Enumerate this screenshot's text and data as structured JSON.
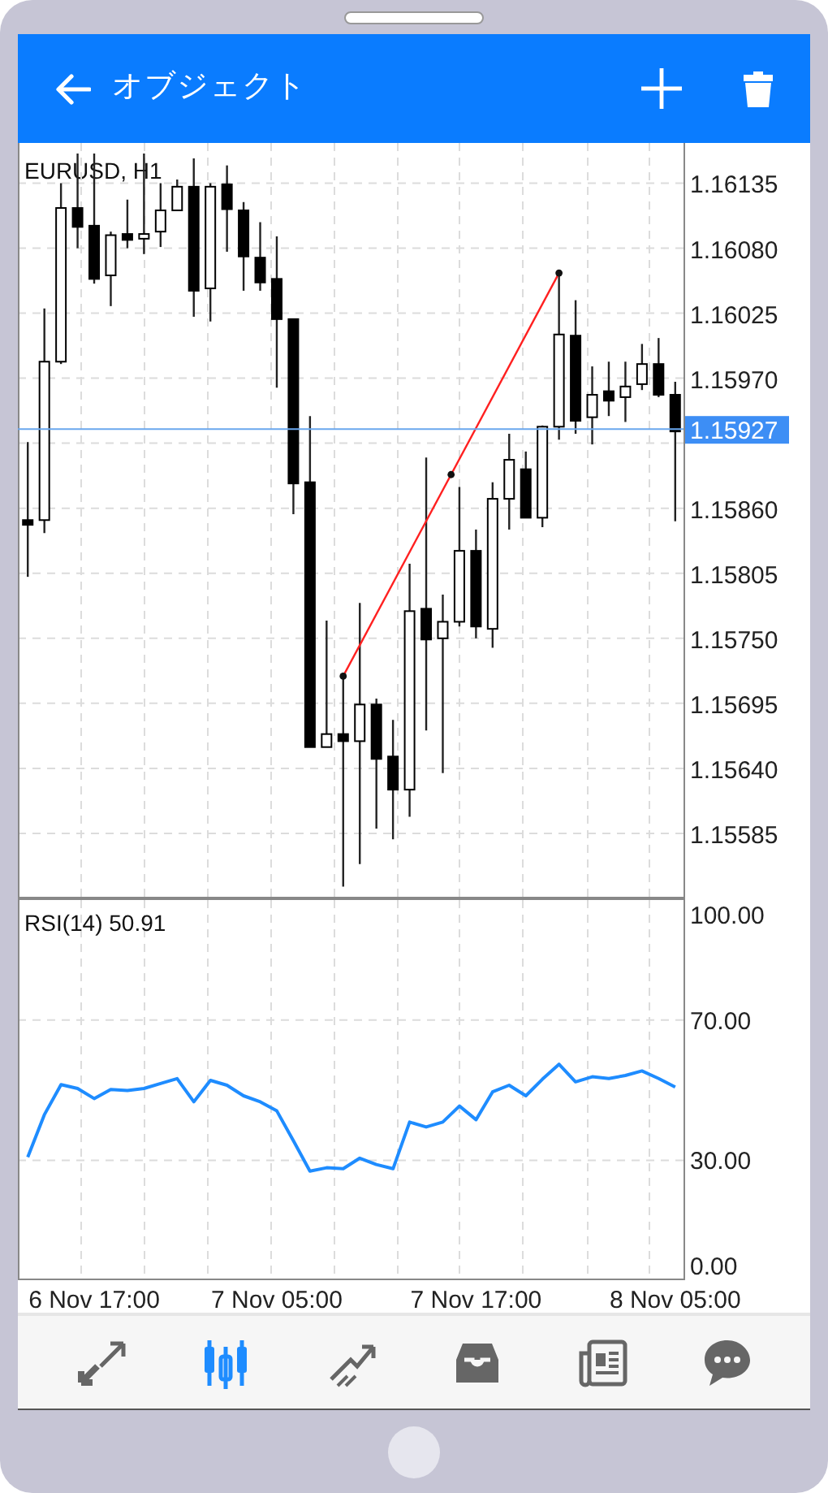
{
  "header": {
    "title": "オブジェクト"
  },
  "price_chart": {
    "current_price": "1.15927",
    "chart_data": {
      "type": "candlestick",
      "title": "EURUSD, H1",
      "grid": true,
      "categories": [
        null,
        null,
        null,
        null,
        null,
        null,
        null,
        null,
        null,
        null,
        null,
        null,
        null,
        null,
        null,
        null,
        null,
        null,
        null,
        null,
        null,
        null,
        null,
        null,
        null,
        null,
        null,
        null,
        null,
        null,
        null,
        null,
        null,
        null,
        null,
        null,
        null,
        null,
        null,
        null
      ],
      "ylim": [
        1.1553,
        1.16169
      ],
      "yticks": [
        {
          "value": 1.16135,
          "label": "1.16135"
        },
        {
          "value": 1.1608,
          "label": "1.16080"
        },
        {
          "value": 1.16025,
          "label": "1.16025"
        },
        {
          "value": 1.1597,
          "label": "1.15970"
        },
        {
          "value": 1.1586,
          "label": "1.15860"
        },
        {
          "value": 1.15805,
          "label": "1.15805"
        },
        {
          "value": 1.1575,
          "label": "1.15750"
        },
        {
          "value": 1.15695,
          "label": "1.15695"
        },
        {
          "value": 1.1564,
          "label": "1.15640"
        },
        {
          "value": 1.15585,
          "label": "1.15585"
        }
      ],
      "ref_lines": [
        {
          "axis": "y",
          "value": 1.15927,
          "color": "#6aa7ee"
        }
      ],
      "ohlc": [
        [
          1.1585,
          1.15916,
          1.15802,
          1.15846
        ],
        [
          1.1585,
          1.16029,
          1.15839,
          1.15984
        ],
        [
          1.15984,
          1.16135,
          1.15982,
          1.16114
        ],
        [
          1.16114,
          1.1616,
          1.1608,
          1.16098
        ],
        [
          1.16099,
          1.1616,
          1.1605,
          1.16054
        ],
        [
          1.16057,
          1.16094,
          1.16031,
          1.16091
        ],
        [
          1.16092,
          1.16121,
          1.1608,
          1.16087
        ],
        [
          1.16088,
          1.1616,
          1.16075,
          1.16092
        ],
        [
          1.16094,
          1.16135,
          1.16081,
          1.16112
        ],
        [
          1.16112,
          1.16138,
          1.16112,
          1.16132
        ],
        [
          1.16132,
          1.16156,
          1.16022,
          1.16044
        ],
        [
          1.16046,
          1.16135,
          1.16018,
          1.16132
        ],
        [
          1.16134,
          1.1615,
          1.16077,
          1.16113
        ],
        [
          1.16112,
          1.16119,
          1.16044,
          1.16073
        ],
        [
          1.16072,
          1.16102,
          1.16044,
          1.16051
        ],
        [
          1.16054,
          1.1609,
          1.15962,
          1.1602
        ],
        [
          1.1602,
          1.1602,
          1.15855,
          1.15881
        ],
        [
          1.15882,
          1.15938,
          1.15658,
          1.15658
        ],
        [
          1.15658,
          1.15765,
          1.15658,
          1.15669
        ],
        [
          1.15669,
          1.15718,
          1.1554,
          1.15663
        ],
        [
          1.15663,
          1.1578,
          1.15559,
          1.15694
        ],
        [
          1.15694,
          1.15699,
          1.15589,
          1.15648
        ],
        [
          1.1565,
          1.15681,
          1.1558,
          1.15622
        ],
        [
          1.15622,
          1.15813,
          1.15599,
          1.15773
        ],
        [
          1.15775,
          1.15903,
          1.15672,
          1.15749
        ],
        [
          1.1575,
          1.15787,
          1.15636,
          1.15764
        ],
        [
          1.15764,
          1.15878,
          1.1576,
          1.15824
        ],
        [
          1.15824,
          1.15842,
          1.1575,
          1.1576
        ],
        [
          1.15758,
          1.15882,
          1.15742,
          1.15868
        ],
        [
          1.15868,
          1.15923,
          1.15842,
          1.15901
        ],
        [
          1.15893,
          1.15908,
          1.15852,
          1.15852
        ],
        [
          1.15852,
          1.1593,
          1.15844,
          1.15929
        ],
        [
          1.15929,
          1.16059,
          1.15918,
          1.16007
        ],
        [
          1.16006,
          1.16036,
          1.15923,
          1.15934
        ],
        [
          1.15937,
          1.1598,
          1.15914,
          1.15956
        ],
        [
          1.15959,
          1.15984,
          1.15938,
          1.15951
        ],
        [
          1.15954,
          1.15984,
          1.15933,
          1.15963
        ],
        [
          1.15965,
          1.15999,
          1.1596,
          1.15982
        ],
        [
          1.15982,
          1.16004,
          1.15954,
          1.15956
        ],
        [
          1.15956,
          1.15967,
          1.15849,
          1.15925
        ]
      ]
    }
  },
  "indicator": {
    "reading": "50.91",
    "chart_data": {
      "type": "line",
      "categories": [
        null,
        null,
        null,
        null,
        "6 Nov 17:00",
        null,
        null,
        null,
        null,
        null,
        null,
        null,
        null,
        null,
        null,
        "7 Nov 05:00",
        null,
        null,
        null,
        null,
        null,
        null,
        null,
        null,
        null,
        null,
        null,
        "7 Nov 17:00",
        null,
        null,
        null,
        null,
        null,
        null,
        null,
        null,
        null,
        null,
        null,
        "8 Nov 05:00"
      ],
      "grid": true,
      "ylim": [
        -3.7,
        104.2
      ],
      "yticks": [
        {
          "value": 0,
          "label": "0.00"
        },
        {
          "value": 30,
          "label": "30.00"
        },
        {
          "value": 70,
          "label": "70.00"
        },
        {
          "value": 100,
          "label": "100.00"
        }
      ],
      "series": [
        {
          "name": "RSI(14)",
          "color": "#1e8cff",
          "values": [
            30.9,
            43.0,
            51.6,
            50.5,
            47.6,
            50.2,
            49.9,
            50.5,
            51.9,
            53.3,
            46.7,
            52.8,
            51.4,
            48.4,
            46.7,
            44.1,
            35.6,
            26.9,
            27.9,
            27.6,
            30.6,
            28.8,
            27.6,
            40.9,
            39.5,
            40.9,
            45.5,
            41.6,
            49.5,
            51.4,
            48.4,
            53.1,
            57.4,
            52.4,
            53.8,
            53.3,
            54.2,
            55.5,
            53.3,
            50.9
          ]
        }
      ]
    }
  },
  "nav": [
    {
      "kind": "quotes",
      "selected": false
    },
    {
      "kind": "chart",
      "selected": true
    },
    {
      "kind": "trade",
      "selected": false
    },
    {
      "kind": "history",
      "selected": false
    },
    {
      "kind": "news",
      "selected": false
    },
    {
      "kind": "messages",
      "selected": false
    }
  ]
}
